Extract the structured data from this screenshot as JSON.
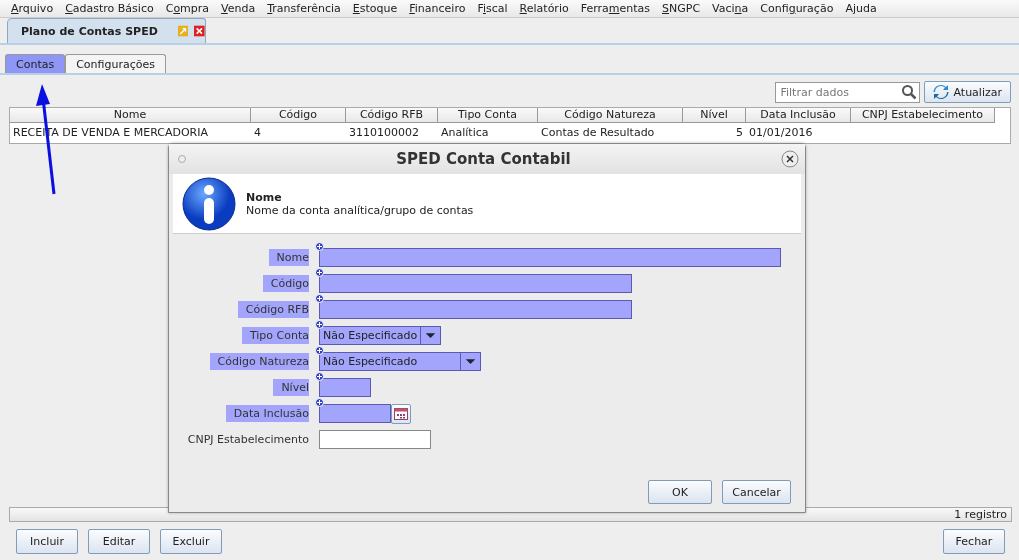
{
  "menu": [
    {
      "mnemonic": "A",
      "rest": "rquivo"
    },
    {
      "mnemonic": "C",
      "rest": "adastro Básico"
    },
    {
      "lead": "C",
      "mnemonic": "o",
      "rest": "mpra"
    },
    {
      "mnemonic": "V",
      "rest": "enda"
    },
    {
      "mnemonic": "T",
      "rest": "ransferência"
    },
    {
      "mnemonic": "E",
      "rest": "stoque"
    },
    {
      "mnemonic": "F",
      "rest": "inanceiro"
    },
    {
      "lead": "F",
      "mnemonic": "i",
      "rest": "scal"
    },
    {
      "mnemonic": "R",
      "rest": "elatório"
    },
    {
      "lead": "Ferra",
      "mnemonic": "m",
      "rest": "entas"
    },
    {
      "mnemonic": "S",
      "rest": "NGPC"
    },
    {
      "lead": "Vaci",
      "mnemonic": "n",
      "rest": "a"
    },
    {
      "lead": "Confi",
      "mnemonic": "g",
      "rest": "uração"
    },
    {
      "lead": "A",
      "mnemonic": "j",
      "rest": "uda"
    }
  ],
  "document_tab": {
    "title": "Plano de Contas SPED"
  },
  "tabs": [
    {
      "label": "Contas",
      "selected": true
    },
    {
      "label": "Configurações",
      "selected": false
    }
  ],
  "search": {
    "placeholder": "Filtrar dados"
  },
  "refresh_button": "Atualizar",
  "table": {
    "columns": [
      "Nome",
      "Código",
      "Código RFB",
      "Tipo Conta",
      "Código Natureza",
      "Nível",
      "Data Inclusão",
      "CNPJ Estabelecimento"
    ],
    "rows": [
      {
        "cells": [
          "RECEITA DE VENDA E MERCADORIA",
          "4",
          "3110100002",
          "Analítica",
          "Contas de Resultado",
          "5",
          "01/01/2016",
          ""
        ]
      }
    ]
  },
  "status_bar": "1 registro",
  "buttons": [
    "Incluir",
    "Editar",
    "Excluir"
  ],
  "close_button": "Fechar",
  "dialog": {
    "title": "SPED Conta Contabil",
    "info_title": "Nome",
    "info_text": "Nome da conta analítica/grupo de contas",
    "fields": [
      {
        "label": "Nome",
        "kind": "text",
        "required": true
      },
      {
        "label": "Código",
        "kind": "text",
        "required": true
      },
      {
        "label": "Código RFB",
        "kind": "text",
        "required": true
      },
      {
        "label": "Tipo Conta",
        "kind": "select",
        "required": true,
        "value": "Não Especificado"
      },
      {
        "label": "Código Natureza",
        "kind": "select",
        "required": true,
        "value": "Não Especificado"
      },
      {
        "label": "Nível",
        "kind": "text",
        "required": true
      },
      {
        "label": "Data Inclusão",
        "kind": "date",
        "required": true
      },
      {
        "label": "CNPJ Estabelecimento",
        "kind": "text",
        "required": false
      }
    ],
    "buttons": [
      "OK",
      "Cancelar"
    ]
  }
}
